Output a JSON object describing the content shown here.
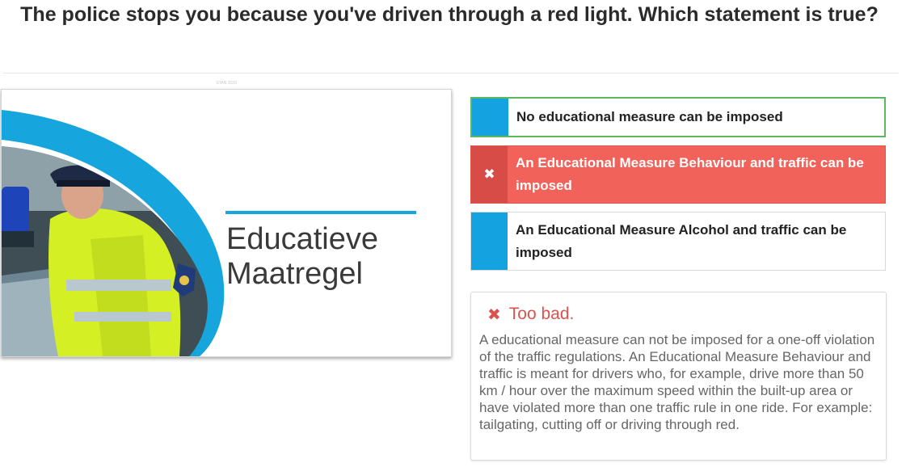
{
  "question": "The police stops you because you've driven through a red light. Which statement is true?",
  "image": {
    "caption": "STAN 2020",
    "slide_title_line1": "Educatieve",
    "slide_title_line2": "Maatregel"
  },
  "answers": [
    {
      "text": "No educational measure can be imposed",
      "state": "correct"
    },
    {
      "text": "An Educational Measure Behaviour and traffic can be imposed",
      "state": "wrong-selected",
      "icon": "✖"
    },
    {
      "text": "An Educational Measure Alcohol and traffic can be imposed",
      "state": "neutral"
    }
  ],
  "feedback": {
    "icon": "✖",
    "title": "Too bad.",
    "body": "A educational measure can not be imposed for a one-off violation of the traffic regulations. An Educational Measure Behaviour and traffic is meant for drivers who, for example, drive more than 50 km / hour over the maximum speed within the built-up area or have violated more than one traffic rule in one ride. For example: tailgating, cutting off or driving through red."
  },
  "colors": {
    "accent_blue": "#15a2e0",
    "correct_green": "#5cb85c",
    "wrong_red": "#f0625a",
    "feedback_red": "#d9534f"
  }
}
